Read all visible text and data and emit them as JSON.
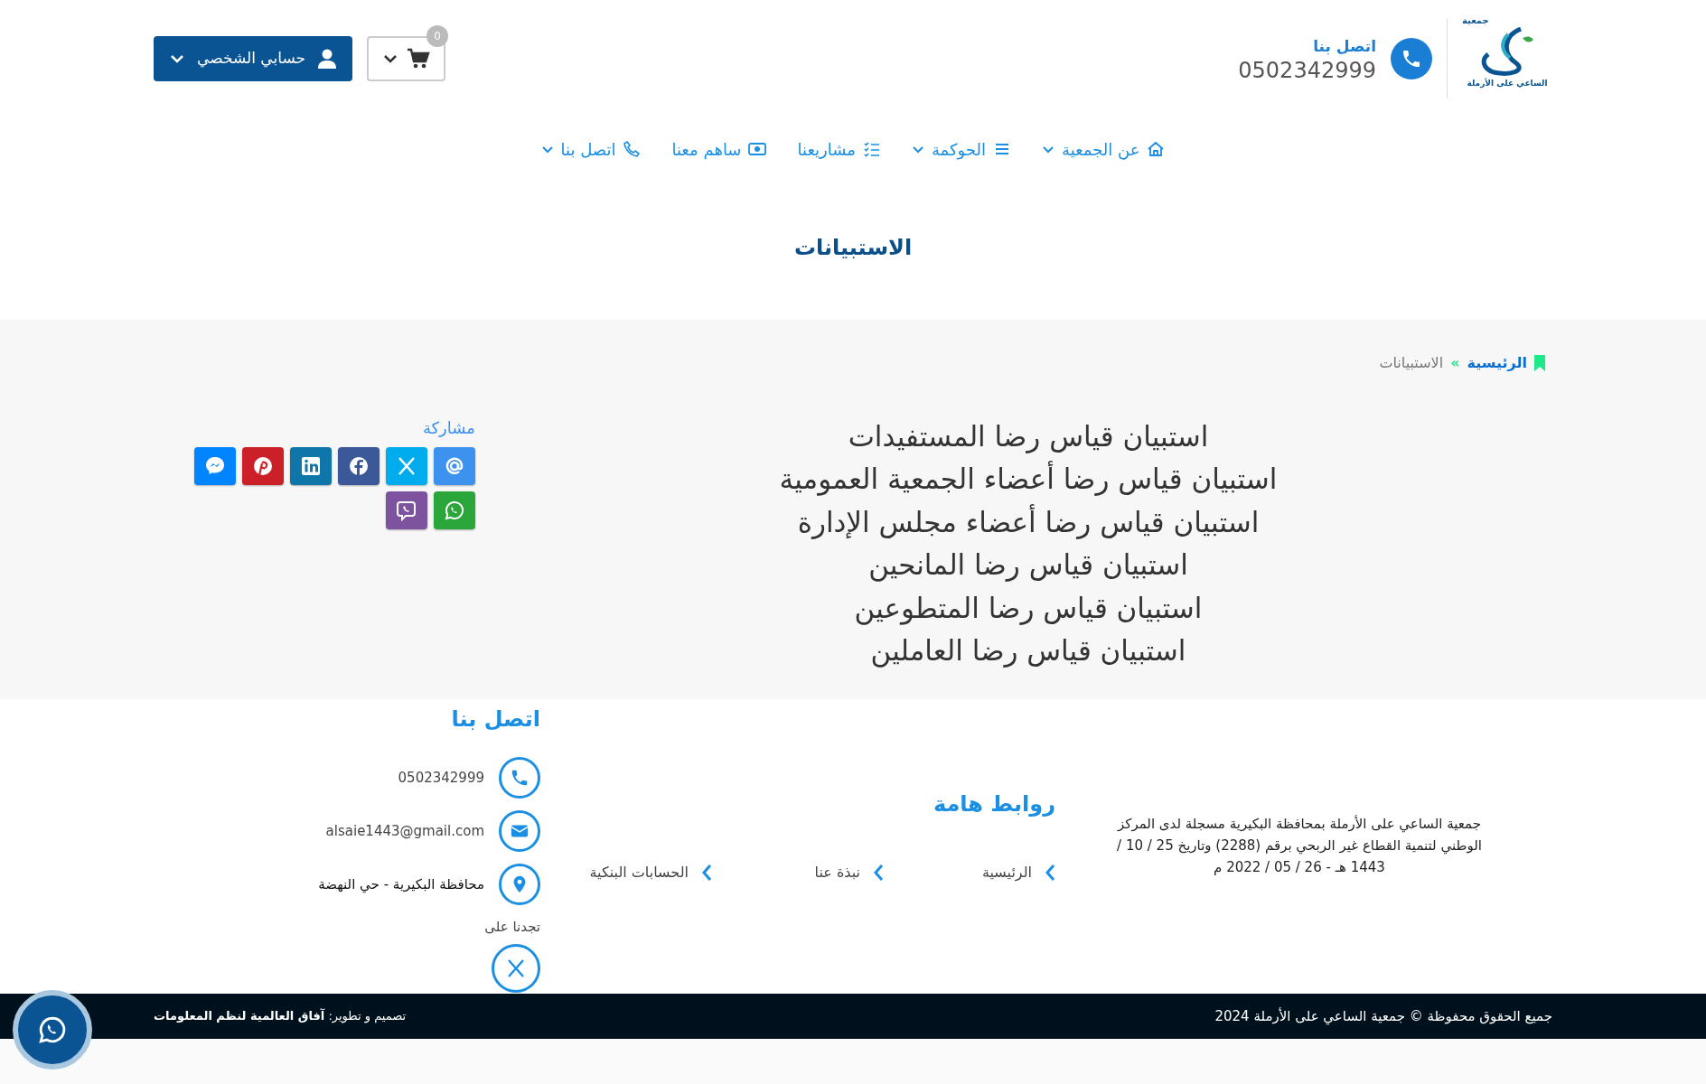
{
  "header": {
    "logo": {
      "top": "جمعية",
      "caption": "الساعي على الأرملة"
    },
    "contact": {
      "label": "اتصل بنا",
      "phone": "0502342999"
    },
    "cart": {
      "count": "0"
    },
    "account": {
      "label": "حسابي الشخصي"
    }
  },
  "nav": [
    {
      "label": "عن الجمعية",
      "dropdown": true
    },
    {
      "label": "الحوكمة",
      "dropdown": true
    },
    {
      "label": "مشاريعنا",
      "dropdown": false
    },
    {
      "label": "ساهم معنا",
      "dropdown": false
    },
    {
      "label": "اتصل بنا",
      "dropdown": true
    }
  ],
  "page_title": "الاستبيانات",
  "breadcrumb": {
    "home": "الرئيسية",
    "separator": "»",
    "current": "الاستبيانات"
  },
  "surveys": [
    "استبيان قياس رضا المستفيدات",
    "استبيان قياس رضا أعضاء الجمعية العمومية",
    "استبيان قياس رضا أعضاء مجلس الإدارة",
    "استبيان قياس رضا المانحين",
    "استبيان قياس رضا المتطوعين",
    "استبيان قياس رضا العاملين"
  ],
  "share": {
    "label": "مشاركة",
    "buttons": [
      {
        "color": "#3d92ef"
      },
      {
        "color": "#00aced"
      },
      {
        "color": "#3b5998"
      },
      {
        "color": "#0e76a8"
      },
      {
        "color": "#cb2027"
      },
      {
        "color": "#0084ff"
      },
      {
        "color": "#2aa63a"
      },
      {
        "color": "#7d539f"
      }
    ]
  },
  "footer": {
    "about": "جمعية الساعي على الأرملة بمحافظة البكيرية مسجلة لدى المركز الوطني لتنمية القطاع غير الربحي برقم (2288) وتاريخ 25 / 10 / 1443 هـ - 26 / 05 / 2022 م",
    "links_title": "روابط هامة",
    "links": [
      "الرئيسية",
      "نبذة عنا",
      "الحسابات البنكية"
    ],
    "contact_title": "اتصل بنا",
    "contact_items": [
      "0502342999",
      "alsaie1443@gmail.com",
      "محافظة البكيرية - حي النهضة"
    ],
    "follow_label": "تجدنا على"
  },
  "bottom_bar": {
    "copyright": "جميع الحقوق محفوظة © جمعية الساعي على الأرملة 2024",
    "credit": "تصميم و تطوير: **آفاق العالمية لنظم المعلومات**"
  }
}
